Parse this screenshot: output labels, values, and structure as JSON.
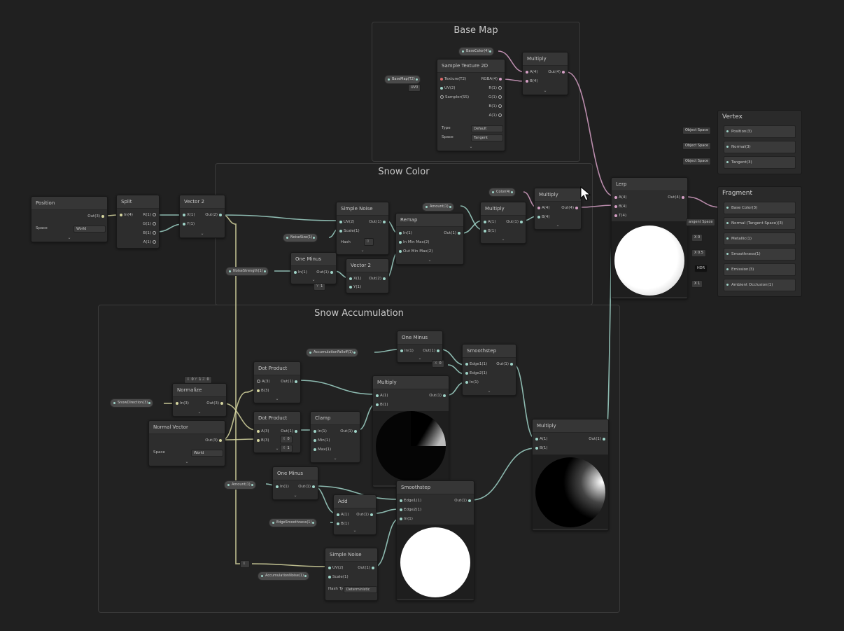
{
  "groups": {
    "base_map": "Base Map",
    "snow_color": "Snow Color",
    "snow_accumulation": "Snow Accumulation"
  },
  "nodes": {
    "position": {
      "title": "Position",
      "out": "Out(3)",
      "space_label": "Space",
      "space_value": "World"
    },
    "split": {
      "title": "Split",
      "in": "In(4)",
      "r": "R(1)",
      "g": "G(1)",
      "b": "B(1)",
      "a": "A(1)"
    },
    "vector2_a": {
      "title": "Vector 2",
      "x": "X(1)",
      "y": "Y(1)",
      "out": "Out(2)"
    },
    "sample_texture": {
      "title": "Sample Texture 2D",
      "texture": "Texture(T2)",
      "uv": "UV(2)",
      "sampler": "Sampler(SS)",
      "rgba": "RGBA(4)",
      "r": "R(1)",
      "g": "G(1)",
      "b": "B(1)",
      "a": "A(1)",
      "type_label": "Type",
      "type_value": "Default",
      "space_label": "Space",
      "space_value": "Tangent"
    },
    "multiply_base": {
      "title": "Multiply",
      "a": "A(4)",
      "b": "B(4)",
      "out": "Out(4)"
    },
    "simple_noise_a": {
      "title": "Simple Noise",
      "uv": "UV(2)",
      "scale": "Scale(1)",
      "out": "Out(1)",
      "hash": "Hash"
    },
    "remap": {
      "title": "Remap",
      "in": "In(1)",
      "in_min_max": "In Min Max(2)",
      "out_min_max": "Out Min Max(2)",
      "out": "Out(1)"
    },
    "multiply_color_a": {
      "title": "Multiply",
      "a": "A(1)",
      "b": "B(1)",
      "out": "Out(1)"
    },
    "multiply_color_b": {
      "title": "Multiply",
      "a": "A(4)",
      "b": "B(4)",
      "out": "Out(4)"
    },
    "one_minus_a": {
      "title": "One Minus",
      "in": "In(1)",
      "out": "Out(1)"
    },
    "vector2_b": {
      "title": "Vector 2",
      "x": "X(1)",
      "y": "Y(1)",
      "out": "Out(2)"
    },
    "lerp": {
      "title": "Lerp",
      "a": "A(4)",
      "b": "B(4)",
      "t": "T(4)",
      "out": "Out(4)"
    },
    "dot_a": {
      "title": "Dot Product",
      "a": "A(3)",
      "b": "B(3)",
      "out": "Out(1)"
    },
    "dot_b": {
      "title": "Dot Product",
      "a": "A(3)",
      "b": "B(3)",
      "out": "Out(1)"
    },
    "normalize": {
      "title": "Normalize",
      "in": "In(3)",
      "out": "Out(3)"
    },
    "normal_vector": {
      "title": "Normal Vector",
      "out": "Out(3)",
      "space_label": "Space",
      "space_value": "World"
    },
    "clamp": {
      "title": "Clamp",
      "in": "In(1)",
      "min": "Min(1)",
      "max": "Max(1)",
      "out": "Out(1)"
    },
    "multiply_acc_a": {
      "title": "Multiply",
      "a": "A(1)",
      "b": "B(1)",
      "out": "Out(1)"
    },
    "one_minus_b": {
      "title": "One Minus",
      "in": "In(1)",
      "out": "Out(1)"
    },
    "smoothstep_a": {
      "title": "Smoothstep",
      "edge1": "Edge1(1)",
      "edge2": "Edge2(1)",
      "in": "In(1)",
      "out": "Out(1)"
    },
    "multiply_acc_b": {
      "title": "Multiply",
      "a": "A(1)",
      "b": "B(1)",
      "out": "Out(1)"
    },
    "one_minus_c": {
      "title": "One Minus",
      "in": "In(1)",
      "out": "Out(1)"
    },
    "add": {
      "title": "Add",
      "a": "A(1)",
      "b": "B(1)",
      "out": "Out(1)"
    },
    "smoothstep_b": {
      "title": "Smoothstep",
      "edge1": "Edge1(1)",
      "edge2": "Edge2(1)",
      "in": "In(1)",
      "out": "Out(1)"
    },
    "simple_noise_b": {
      "title": "Simple Noise",
      "uv": "UV(2)",
      "scale": "Scale(1)",
      "out": "Out(1)",
      "hash_label": "Hash Ty",
      "hash_value": "Deterministic"
    }
  },
  "properties": {
    "base_color": "BaseColor(4)",
    "base_map": "BaseMap(T2)",
    "uv0": "UV0",
    "noise_size": "NoiseSize(1)",
    "noise_strength": "NoiseStrength(1)",
    "amount": "Amount(1)",
    "color": "Color(4)",
    "accumulation_falloff": "AccumulationFalloff(1)",
    "snow_direction": "SnowDirection(3)",
    "amount_b": "Amount(1)",
    "edge_smoothness": "EdgeSmoothness(1)",
    "accumulation_noise": "AccumulationNoise(1)"
  },
  "inline_values": {
    "hash_x": "0",
    "hash_y": "1",
    "vec_y_label": "Y",
    "vec_y": "1",
    "dir_x_label": "X",
    "dir_x": "0",
    "dir_y_label": "Y",
    "dir_y": "1",
    "dir_z_label": "Z",
    "dir_z": "0",
    "clamp_min_label": "X",
    "clamp_min": "0",
    "clamp_max_label": "X",
    "clamp_max": "1",
    "smooth_edge_label": "X",
    "smooth_edge": "0",
    "noise_uv_label": "X"
  },
  "master": {
    "vertex_title": "Vertex",
    "vertex_blocks": [
      "Position(3)",
      "Normal(3)",
      "Tangent(3)"
    ],
    "vertex_space": "Object Space",
    "fragment_title": "Fragment",
    "fragment_blocks": [
      "Base Color(3)",
      "Normal (Tangent Space)(3)",
      "Metallic(1)",
      "Smoothness(1)",
      "Emission(3)",
      "Ambient Occlusion(1)"
    ],
    "frag_inputs": [
      "angent Space",
      "X  0",
      "X  0.5",
      "HDR",
      "X  1"
    ]
  },
  "colors": {
    "background": "#202020",
    "node": "#2d2d2d",
    "wire_vector": "#9fd4c8",
    "wire_scalar": "#9fd4c8",
    "wire_float3": "#d6d6a0",
    "wire_color": "#d6a0c6"
  }
}
